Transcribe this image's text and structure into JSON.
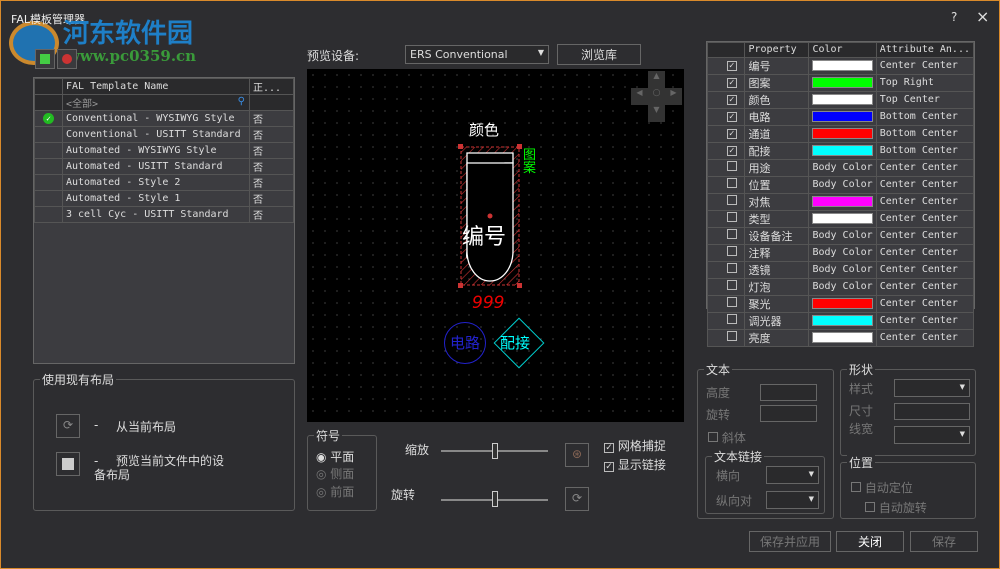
{
  "window": {
    "title": "FAL模板管理器",
    "help": "?",
    "close": "×",
    "watermark_name": "河东软件园",
    "watermark_url": "www.pc0359.cn"
  },
  "left_table": {
    "headers": [
      "FAL Template Name",
      "正..."
    ],
    "filter_placeholder": "<全部>",
    "rows": [
      {
        "name": "Conventional - WYSIWYG Style",
        "flag": "否",
        "active": true
      },
      {
        "name": "Conventional - USITT Standard",
        "flag": "否",
        "active": false
      },
      {
        "name": "Automated - WYSIWYG Style",
        "flag": "否",
        "active": false
      },
      {
        "name": "Automated - USITT Standard",
        "flag": "否",
        "active": false
      },
      {
        "name": "Automated - Style 2",
        "flag": "否",
        "active": false
      },
      {
        "name": "Automated - Style 1",
        "flag": "否",
        "active": false
      },
      {
        "name": "3 cell Cyc - USITT Standard",
        "flag": "否",
        "active": false
      }
    ]
  },
  "layout_group": {
    "title": "使用现有布局",
    "opt1_dash": "-",
    "opt1": "从当前布局",
    "opt2_dash": "-",
    "opt2": "预览当前文件中的设备布局"
  },
  "preview": {
    "label": "预览设备:",
    "device": "ERS Conventional",
    "browse": "浏览库",
    "labels": {
      "color": "颜色",
      "pattern": "图案",
      "number": "编号",
      "channel": "999",
      "circuit": "电路",
      "connector": "配接"
    }
  },
  "symbol": {
    "title": "符号",
    "options": [
      "平面",
      "侧面",
      "前面"
    ],
    "selected": 0
  },
  "sliders": {
    "zoom_label": "缩放",
    "rotate_label": "旋转",
    "zoom_value": 50,
    "rotate_value": 50
  },
  "checks": {
    "grid_snap": "网格捕捉",
    "show_links": "显示链接",
    "grid_snap_checked": true,
    "show_links_checked": true
  },
  "right_table": {
    "headers": [
      "Property",
      "Color",
      "Attribute An..."
    ],
    "rows": [
      {
        "checked": true,
        "prop": "编号",
        "color": "#ffffff",
        "anchor": "Center Center"
      },
      {
        "checked": true,
        "prop": "图案",
        "color": "#00ff00",
        "anchor": "Top Right"
      },
      {
        "checked": true,
        "prop": "颜色",
        "color": "#ffffff",
        "anchor": "Top Center"
      },
      {
        "checked": true,
        "prop": "电路",
        "color": "#0000ff",
        "anchor": "Bottom Center"
      },
      {
        "checked": true,
        "prop": "通道",
        "color": "#ff0000",
        "anchor": "Bottom Center"
      },
      {
        "checked": true,
        "prop": "配接",
        "color": "#00ffff",
        "anchor": "Bottom Center"
      },
      {
        "checked": false,
        "prop": "用途",
        "color_text": "Body Color",
        "anchor": "Center Center"
      },
      {
        "checked": false,
        "prop": "位置",
        "color_text": "Body Color",
        "anchor": "Center Center"
      },
      {
        "checked": false,
        "prop": "对焦",
        "color": "#ff00ff",
        "anchor": "Center Center"
      },
      {
        "checked": false,
        "prop": "类型",
        "color": "#ffffff",
        "anchor": "Center Center"
      },
      {
        "checked": false,
        "prop": "设备备注",
        "color_text": "Body Color",
        "anchor": "Center Center"
      },
      {
        "checked": false,
        "prop": "注释",
        "color_text": "Body Color",
        "anchor": "Center Center"
      },
      {
        "checked": false,
        "prop": "透镜",
        "color_text": "Body Color",
        "anchor": "Center Center"
      },
      {
        "checked": false,
        "prop": "灯泡",
        "color_text": "Body Color",
        "anchor": "Center Center"
      },
      {
        "checked": false,
        "prop": "聚光",
        "color": "#ff0000",
        "anchor": "Center Center"
      },
      {
        "checked": false,
        "prop": "调光器",
        "color": "#00ffff",
        "anchor": "Center Center"
      },
      {
        "checked": false,
        "prop": "亮度",
        "color": "#ffffff",
        "anchor": "Center Center"
      }
    ]
  },
  "text_group": {
    "title": "文本",
    "height": "高度",
    "rotation": "旋转",
    "italic": "斜体",
    "link_title": "文本链接",
    "horizontal": "横向",
    "vertical": "纵向对"
  },
  "shape_group": {
    "title": "形状",
    "style": "样式",
    "size": "尺寸",
    "line_width": "线宽"
  },
  "position_group": {
    "title": "位置",
    "auto_position": "自动定位",
    "auto_rotate": "自动旋转"
  },
  "footer": {
    "save_apply": "保存并应用",
    "close": "关闭",
    "save": "保存"
  }
}
